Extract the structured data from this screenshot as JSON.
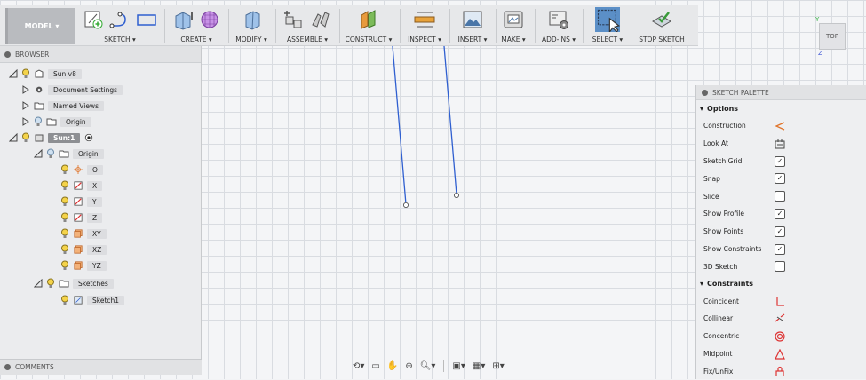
{
  "workspace": {
    "label": "MODEL ▾"
  },
  "toolbar": {
    "groups": [
      {
        "label": "SKETCH ▾"
      },
      {
        "label": "CREATE ▾"
      },
      {
        "label": "MODIFY ▾"
      },
      {
        "label": "ASSEMBLE ▾"
      },
      {
        "label": "CONSTRUCT ▾"
      },
      {
        "label": "INSPECT ▾"
      },
      {
        "label": "INSERT ▾"
      },
      {
        "label": "MAKE ▾"
      },
      {
        "label": "ADD-INS ▾"
      },
      {
        "label": "SELECT ▾"
      },
      {
        "label": "STOP SKETCH"
      }
    ]
  },
  "viewcube": {
    "face": "TOP",
    "axis_y": "Y",
    "axis_z": "Z"
  },
  "browser": {
    "title": "BROWSER",
    "nodes": [
      {
        "label": "Sun v8"
      },
      {
        "label": "Document Settings"
      },
      {
        "label": "Named Views"
      },
      {
        "label": "Origin"
      },
      {
        "label": "Sun:1"
      },
      {
        "label": "Origin"
      },
      {
        "label": "O"
      },
      {
        "label": "X"
      },
      {
        "label": "Y"
      },
      {
        "label": "Z"
      },
      {
        "label": "XY"
      },
      {
        "label": "XZ"
      },
      {
        "label": "YZ"
      },
      {
        "label": "Sketches"
      },
      {
        "label": "Sketch1"
      }
    ]
  },
  "comments": {
    "title": "COMMENTS"
  },
  "palette": {
    "title": "SKETCH PALETTE",
    "options_title": "Options",
    "options": [
      {
        "label": "Construction"
      },
      {
        "label": "Look At"
      },
      {
        "label": "Sketch Grid",
        "checked": "✓"
      },
      {
        "label": "Snap",
        "checked": "✓"
      },
      {
        "label": "Slice",
        "checked": ""
      },
      {
        "label": "Show Profile",
        "checked": "✓"
      },
      {
        "label": "Show Points",
        "checked": "✓"
      },
      {
        "label": "Show Constraints",
        "checked": "✓"
      },
      {
        "label": "3D Sketch",
        "checked": ""
      }
    ],
    "constraints_title": "Constraints",
    "constraints": [
      {
        "label": "Coincident"
      },
      {
        "label": "Collinear"
      },
      {
        "label": "Concentric"
      },
      {
        "label": "Midpoint"
      },
      {
        "label": "Fix/UnFix"
      }
    ]
  },
  "colors": {
    "accent": "#3c78d8",
    "sketch_line": "#2f5fd0",
    "select_blue": "#5b8fc7"
  }
}
